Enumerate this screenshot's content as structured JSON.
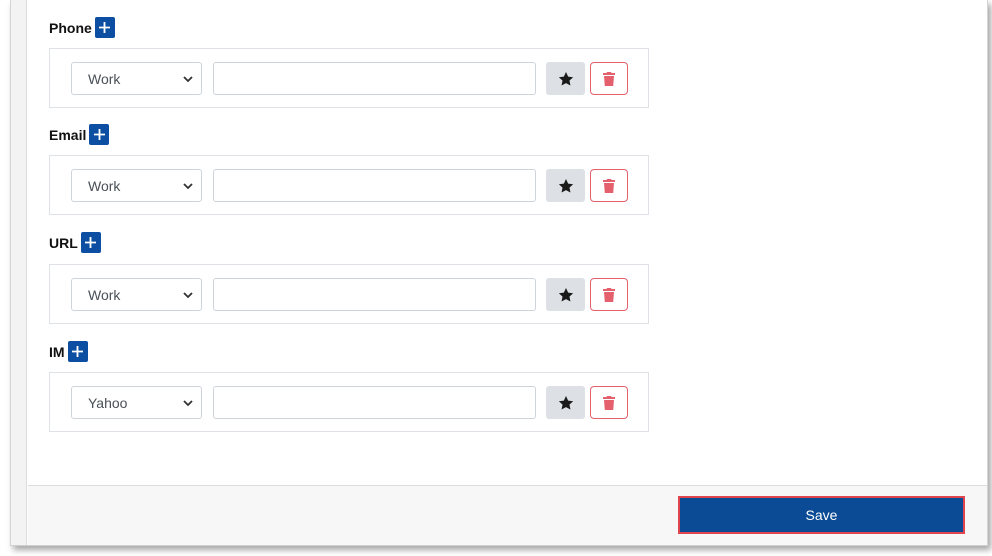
{
  "sections": [
    {
      "key": "phone",
      "label": "Phone",
      "type_value": "Work",
      "value": ""
    },
    {
      "key": "email",
      "label": "Email",
      "type_value": "Work",
      "value": ""
    },
    {
      "key": "url",
      "label": "URL",
      "type_value": "Work",
      "value": ""
    },
    {
      "key": "im",
      "label": "IM",
      "type_value": "Yahoo",
      "value": ""
    }
  ],
  "icons": {
    "add": "plus-icon",
    "star": "star-icon",
    "delete": "trash-icon",
    "select": "chevron-down-icon"
  },
  "colors": {
    "primary": "#0b4ea2",
    "danger": "#e4606d",
    "save_border": "#e0454d",
    "star_bg": "#dde1e6"
  },
  "footer": {
    "save_label": "Save"
  }
}
